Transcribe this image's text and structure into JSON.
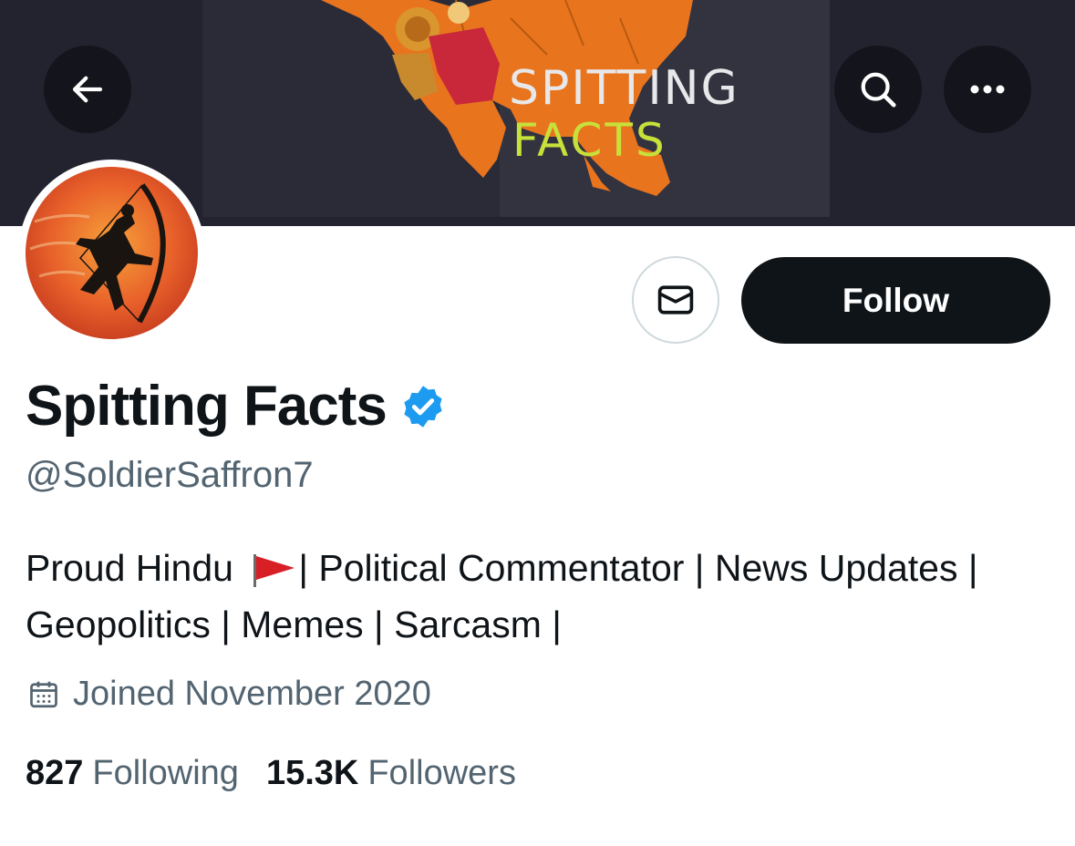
{
  "banner": {
    "title": "SPITTING",
    "subtitle": "FACTS"
  },
  "header": {
    "back_icon": "arrow-left-icon",
    "search_icon": "search-icon",
    "more_icon": "more-horizontal-icon"
  },
  "profile": {
    "avatar_icon": "archer-silhouette-avatar",
    "display_name": "Spitting Facts",
    "verified_icon": "verified-badge-icon",
    "handle": "@SoldierSaffron7",
    "bio_part1": "Proud Hindu",
    "bio_flag_icon": "saffron-flag-emoji",
    "bio_part2": "| Political Commentator | News Updates | Geopolitics | Memes | Sarcasm |",
    "joined_icon": "calendar-icon",
    "joined": "Joined November 2020"
  },
  "actions": {
    "message_icon": "envelope-icon",
    "follow_label": "Follow"
  },
  "stats": {
    "following_count": "827",
    "following_label": "Following",
    "followers_count": "15.3K",
    "followers_label": "Followers"
  },
  "colors": {
    "primary_text": "#0f1419",
    "secondary_text": "#536471",
    "verified_blue": "#1d9bf0",
    "follow_bg": "#0f1419",
    "banner_bg": "#23232f",
    "saffron": "#e87722"
  }
}
